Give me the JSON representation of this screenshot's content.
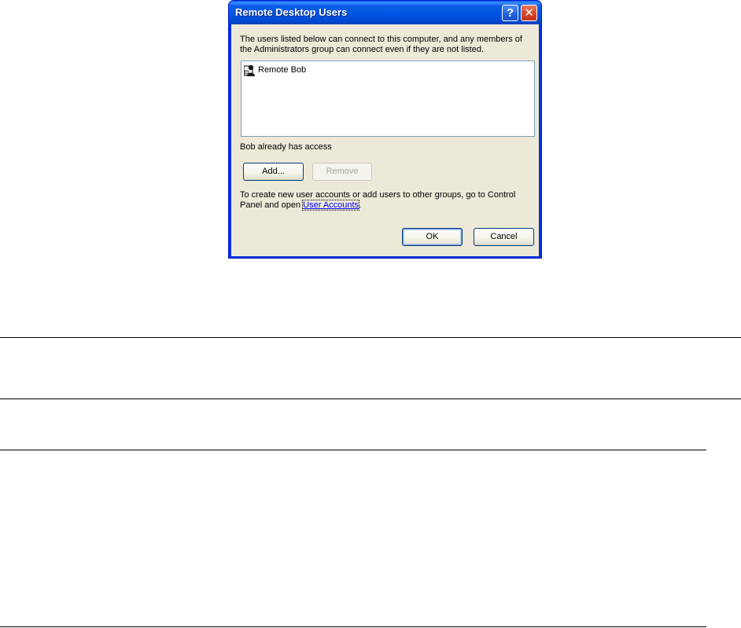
{
  "dialog": {
    "title": "Remote Desktop Users",
    "help_button": "?",
    "close_button": "✕",
    "description": "The users listed below can connect to this computer, and any members of the Administrators group can connect even if they are not listed.",
    "users": [
      {
        "label": "Remote Bob",
        "icon": "user-icon"
      }
    ],
    "status_text": "Bob already has access",
    "add_label": "Add...",
    "remove_label": "Remove",
    "info_text_before": "To create new user accounts or add users to other groups, go to Control Panel and open ",
    "info_link": "User Accounts",
    "info_text_after": ".",
    "ok_label": "OK",
    "cancel_label": "Cancel"
  },
  "colors": {
    "titlebar": "#0054e3",
    "client_bg": "#ece9d8",
    "link": "#0000ff",
    "close_button": "#d6472a"
  }
}
